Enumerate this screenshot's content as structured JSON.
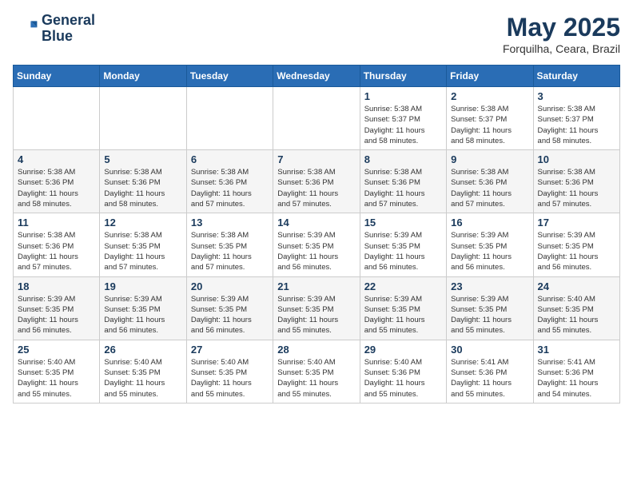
{
  "header": {
    "logo_line1": "General",
    "logo_line2": "Blue",
    "month_title": "May 2025",
    "location": "Forquilha, Ceara, Brazil"
  },
  "weekdays": [
    "Sunday",
    "Monday",
    "Tuesday",
    "Wednesday",
    "Thursday",
    "Friday",
    "Saturday"
  ],
  "weeks": [
    [
      {
        "day": "",
        "info": ""
      },
      {
        "day": "",
        "info": ""
      },
      {
        "day": "",
        "info": ""
      },
      {
        "day": "",
        "info": ""
      },
      {
        "day": "1",
        "info": "Sunrise: 5:38 AM\nSunset: 5:37 PM\nDaylight: 11 hours\nand 58 minutes."
      },
      {
        "day": "2",
        "info": "Sunrise: 5:38 AM\nSunset: 5:37 PM\nDaylight: 11 hours\nand 58 minutes."
      },
      {
        "day": "3",
        "info": "Sunrise: 5:38 AM\nSunset: 5:37 PM\nDaylight: 11 hours\nand 58 minutes."
      }
    ],
    [
      {
        "day": "4",
        "info": "Sunrise: 5:38 AM\nSunset: 5:36 PM\nDaylight: 11 hours\nand 58 minutes."
      },
      {
        "day": "5",
        "info": "Sunrise: 5:38 AM\nSunset: 5:36 PM\nDaylight: 11 hours\nand 58 minutes."
      },
      {
        "day": "6",
        "info": "Sunrise: 5:38 AM\nSunset: 5:36 PM\nDaylight: 11 hours\nand 57 minutes."
      },
      {
        "day": "7",
        "info": "Sunrise: 5:38 AM\nSunset: 5:36 PM\nDaylight: 11 hours\nand 57 minutes."
      },
      {
        "day": "8",
        "info": "Sunrise: 5:38 AM\nSunset: 5:36 PM\nDaylight: 11 hours\nand 57 minutes."
      },
      {
        "day": "9",
        "info": "Sunrise: 5:38 AM\nSunset: 5:36 PM\nDaylight: 11 hours\nand 57 minutes."
      },
      {
        "day": "10",
        "info": "Sunrise: 5:38 AM\nSunset: 5:36 PM\nDaylight: 11 hours\nand 57 minutes."
      }
    ],
    [
      {
        "day": "11",
        "info": "Sunrise: 5:38 AM\nSunset: 5:36 PM\nDaylight: 11 hours\nand 57 minutes."
      },
      {
        "day": "12",
        "info": "Sunrise: 5:38 AM\nSunset: 5:35 PM\nDaylight: 11 hours\nand 57 minutes."
      },
      {
        "day": "13",
        "info": "Sunrise: 5:38 AM\nSunset: 5:35 PM\nDaylight: 11 hours\nand 57 minutes."
      },
      {
        "day": "14",
        "info": "Sunrise: 5:39 AM\nSunset: 5:35 PM\nDaylight: 11 hours\nand 56 minutes."
      },
      {
        "day": "15",
        "info": "Sunrise: 5:39 AM\nSunset: 5:35 PM\nDaylight: 11 hours\nand 56 minutes."
      },
      {
        "day": "16",
        "info": "Sunrise: 5:39 AM\nSunset: 5:35 PM\nDaylight: 11 hours\nand 56 minutes."
      },
      {
        "day": "17",
        "info": "Sunrise: 5:39 AM\nSunset: 5:35 PM\nDaylight: 11 hours\nand 56 minutes."
      }
    ],
    [
      {
        "day": "18",
        "info": "Sunrise: 5:39 AM\nSunset: 5:35 PM\nDaylight: 11 hours\nand 56 minutes."
      },
      {
        "day": "19",
        "info": "Sunrise: 5:39 AM\nSunset: 5:35 PM\nDaylight: 11 hours\nand 56 minutes."
      },
      {
        "day": "20",
        "info": "Sunrise: 5:39 AM\nSunset: 5:35 PM\nDaylight: 11 hours\nand 56 minutes."
      },
      {
        "day": "21",
        "info": "Sunrise: 5:39 AM\nSunset: 5:35 PM\nDaylight: 11 hours\nand 55 minutes."
      },
      {
        "day": "22",
        "info": "Sunrise: 5:39 AM\nSunset: 5:35 PM\nDaylight: 11 hours\nand 55 minutes."
      },
      {
        "day": "23",
        "info": "Sunrise: 5:39 AM\nSunset: 5:35 PM\nDaylight: 11 hours\nand 55 minutes."
      },
      {
        "day": "24",
        "info": "Sunrise: 5:40 AM\nSunset: 5:35 PM\nDaylight: 11 hours\nand 55 minutes."
      }
    ],
    [
      {
        "day": "25",
        "info": "Sunrise: 5:40 AM\nSunset: 5:35 PM\nDaylight: 11 hours\nand 55 minutes."
      },
      {
        "day": "26",
        "info": "Sunrise: 5:40 AM\nSunset: 5:35 PM\nDaylight: 11 hours\nand 55 minutes."
      },
      {
        "day": "27",
        "info": "Sunrise: 5:40 AM\nSunset: 5:35 PM\nDaylight: 11 hours\nand 55 minutes."
      },
      {
        "day": "28",
        "info": "Sunrise: 5:40 AM\nSunset: 5:35 PM\nDaylight: 11 hours\nand 55 minutes."
      },
      {
        "day": "29",
        "info": "Sunrise: 5:40 AM\nSunset: 5:36 PM\nDaylight: 11 hours\nand 55 minutes."
      },
      {
        "day": "30",
        "info": "Sunrise: 5:41 AM\nSunset: 5:36 PM\nDaylight: 11 hours\nand 55 minutes."
      },
      {
        "day": "31",
        "info": "Sunrise: 5:41 AM\nSunset: 5:36 PM\nDaylight: 11 hours\nand 54 minutes."
      }
    ]
  ]
}
